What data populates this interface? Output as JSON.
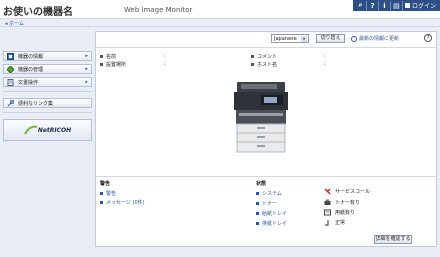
{
  "header": {
    "device_name": "お使いの機器名",
    "app_title": "Web Image Monitor",
    "login_label": "ログイン"
  },
  "breadcrumb": {
    "home": "ホーム"
  },
  "sidebar": {
    "items": [
      {
        "label": "機器の情報",
        "icon": "device-info-icon"
      },
      {
        "label": "機器の管理",
        "icon": "device-manage-icon"
      },
      {
        "label": "文書操作",
        "icon": "document-icon"
      }
    ],
    "links": {
      "label": "便利なリンク集"
    },
    "logo": "NetRICOH"
  },
  "toolbar": {
    "language": "Japanese",
    "switch_label": "切り替え",
    "refresh_label": "最新の情報に更新",
    "help": "?"
  },
  "device_info": {
    "name_label": "名前",
    "location_label": "設置場所",
    "comment_label": "コメント",
    "host_label": "ホスト名"
  },
  "alerts": {
    "title": "警告",
    "items": [
      "警告",
      "メッセージ (0件)"
    ]
  },
  "status": {
    "title": "状態",
    "items": [
      "システム",
      "トナー",
      "給紙トレイ",
      "排紙トレイ"
    ],
    "legend": [
      {
        "label": "サービスコール",
        "icon": "service-call-icon"
      },
      {
        "label": "トナー有り",
        "icon": "toner-icon"
      },
      {
        "label": "用紙有り",
        "icon": "paper-icon"
      },
      {
        "label": "正常",
        "icon": "ok-icon"
      }
    ]
  },
  "details_button": "詳細を確認する",
  "colors": {
    "accent": "#2e4f86",
    "link": "#2b56a6"
  }
}
